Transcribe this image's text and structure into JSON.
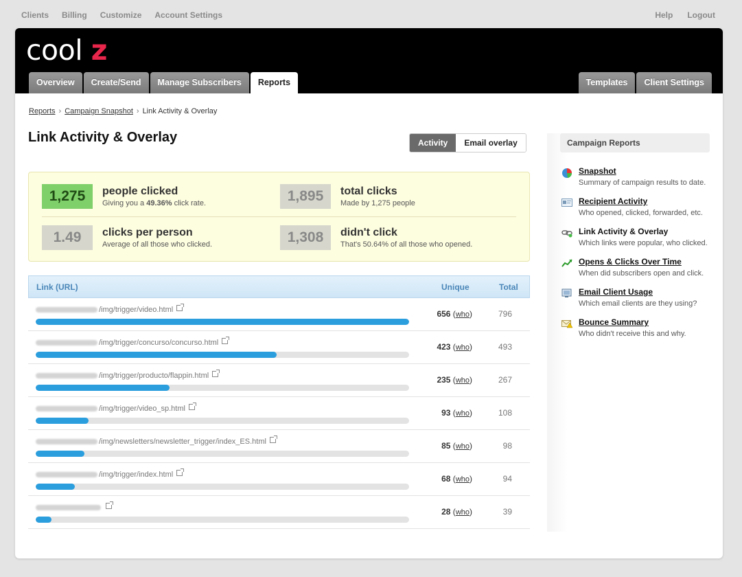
{
  "topnav": {
    "left": [
      "Clients",
      "Billing",
      "Customize",
      "Account Settings"
    ],
    "right": [
      "Help",
      "Logout"
    ]
  },
  "logo": {
    "main": "cool",
    "accent": "z"
  },
  "tabs": [
    "Overview",
    "Create/Send",
    "Manage Subscribers",
    "Reports"
  ],
  "tabs_right": [
    "Templates",
    "Client Settings"
  ],
  "breadcrumb": {
    "reports": "Reports",
    "snapshot": "Campaign Snapshot",
    "current": "Link Activity & Overlay",
    "sep": "›"
  },
  "page_title": "Link Activity & Overlay",
  "toggle": {
    "activity": "Activity",
    "overlay": "Email overlay"
  },
  "stats": [
    {
      "num": "1,275",
      "label": "people clicked",
      "sub_pre": "Giving you a ",
      "sub_bold": "49.36%",
      "sub_post": " click rate."
    },
    {
      "num": "1,895",
      "label": "total clicks",
      "sub_pre": "Made by 1,275 people",
      "sub_bold": "",
      "sub_post": ""
    },
    {
      "num": "1.49",
      "label": "clicks per person",
      "sub_pre": "Average of all those who clicked.",
      "sub_bold": "",
      "sub_post": ""
    },
    {
      "num": "1,308",
      "label": "didn't click",
      "sub_pre": "That's 50.64% of all those who opened.",
      "sub_bold": "",
      "sub_post": ""
    }
  ],
  "links_table": {
    "headers": {
      "link": "Link (URL)",
      "unique": "Unique",
      "total": "Total"
    },
    "who_label": "who",
    "rows": [
      {
        "path": "/img/trigger/video.html",
        "unique": "656",
        "total": "796",
        "fraction": 1.0
      },
      {
        "path": "/img/trigger/concurso/concurso.html",
        "unique": "423",
        "total": "493",
        "fraction": 0.645
      },
      {
        "path": "/img/trigger/producto/flappin.html",
        "unique": "235",
        "total": "267",
        "fraction": 0.358
      },
      {
        "path": "/img/trigger/video_sp.html",
        "unique": "93",
        "total": "108",
        "fraction": 0.142
      },
      {
        "path": "/img/newsletters/newsletter_trigger/index_ES.html",
        "unique": "85",
        "total": "98",
        "fraction": 0.13
      },
      {
        "path": "/img/trigger/index.html",
        "unique": "68",
        "total": "94",
        "fraction": 0.104
      },
      {
        "path": "",
        "unique": "28",
        "total": "39",
        "fraction": 0.043
      }
    ]
  },
  "sidebar": {
    "title": "Campaign Reports",
    "items": [
      {
        "title": "Snapshot",
        "desc": "Summary of campaign results to date.",
        "icon": "pie-chart-icon",
        "link": true
      },
      {
        "title": "Recipient Activity",
        "desc": "Who opened, clicked, forwarded, etc.",
        "icon": "id-card-icon",
        "link": true
      },
      {
        "title": "Link Activity & Overlay",
        "desc": "Which links were popular, who clicked.",
        "icon": "link-chain-icon",
        "link": false
      },
      {
        "title": "Opens & Clicks Over Time",
        "desc": "When did subscribers open and click.",
        "icon": "line-chart-icon",
        "link": true
      },
      {
        "title": "Email Client Usage",
        "desc": "Which email clients are they using?",
        "icon": "monitor-icon",
        "link": true
      },
      {
        "title": "Bounce Summary",
        "desc": "Who didn't receive this and why.",
        "icon": "envelope-warning-icon",
        "link": true
      }
    ]
  },
  "colors": {
    "accent": "#e8264c",
    "bar": "#2b9ede",
    "green": "#7fd06a"
  }
}
